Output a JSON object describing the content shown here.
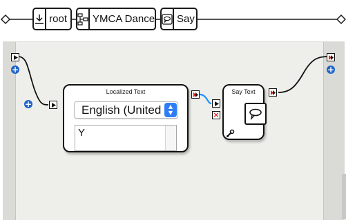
{
  "breadcrumb": {
    "items": [
      {
        "icon": "root-download-icon",
        "label": "root"
      },
      {
        "icon": "flowchart-icon",
        "label": "YMCA Dance"
      },
      {
        "icon": "speech-bubble-icon",
        "label": "Say"
      }
    ]
  },
  "canvas": {
    "blocks": {
      "localized_text": {
        "title": "Localized Text",
        "language_value": "English (UnitedSta",
        "text_value": "Y"
      },
      "say_text": {
        "title": "Say Text",
        "icon": "speech-bubble-icon"
      }
    },
    "add_port_icon": "plus-icon"
  },
  "colors": {
    "wire": "#111111",
    "selected_wire": "#1e90ff",
    "accent_blue": "#2f7df6",
    "output_port_red": "#e02020",
    "canvas_bg": "#eeeeea"
  }
}
